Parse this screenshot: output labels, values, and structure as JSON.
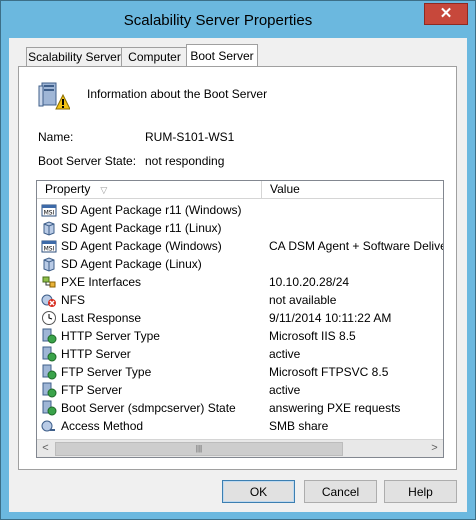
{
  "window": {
    "title": "Scalability Server Properties"
  },
  "tabs": [
    {
      "label": "Scalability Server"
    },
    {
      "label": "Computer"
    },
    {
      "label": "Boot Server"
    }
  ],
  "header": {
    "info": "Information about the Boot Server"
  },
  "fields": {
    "name_label": "Name:",
    "name_value": "RUM-S101-WS1",
    "state_label": "Boot Server State:",
    "state_value": "not responding"
  },
  "list": {
    "col_property": "Property",
    "col_value": "Value",
    "rows": [
      {
        "property": "SD Agent Package r11 (Windows)",
        "value": "",
        "icon": "msi-package-icon"
      },
      {
        "property": "SD Agent Package r11 (Linux)",
        "value": "",
        "icon": "package-icon"
      },
      {
        "property": "SD Agent Package (Windows)",
        "value": "CA DSM Agent + Software Delive",
        "icon": "msi-package-icon"
      },
      {
        "property": "SD Agent Package (Linux)",
        "value": "",
        "icon": "package-icon"
      },
      {
        "property": "PXE Interfaces",
        "value": "10.10.20.28/24",
        "icon": "network-icon"
      },
      {
        "property": "NFS",
        "value": "not available",
        "icon": "nfs-error-icon"
      },
      {
        "property": "Last Response",
        "value": "9/11/2014 10:11:22 AM",
        "icon": "clock-icon"
      },
      {
        "property": "HTTP Server Type",
        "value": "Microsoft IIS 8.5",
        "icon": "server-status-icon"
      },
      {
        "property": "HTTP Server",
        "value": "active",
        "icon": "server-status-icon"
      },
      {
        "property": "FTP Server Type",
        "value": "Microsoft FTPSVC 8.5",
        "icon": "server-status-icon"
      },
      {
        "property": "FTP Server",
        "value": "active",
        "icon": "server-status-icon"
      },
      {
        "property": "Boot Server (sdmpcserver) State",
        "value": "answering PXE requests",
        "icon": "server-status-icon"
      },
      {
        "property": "Access Method",
        "value": "SMB share",
        "icon": "access-icon"
      }
    ]
  },
  "buttons": {
    "ok": "OK",
    "cancel": "Cancel",
    "help": "Help"
  },
  "colors": {
    "titlebar": "#6bb8df",
    "close": "#c7483b",
    "dialog_bg": "#f0f0f0"
  }
}
